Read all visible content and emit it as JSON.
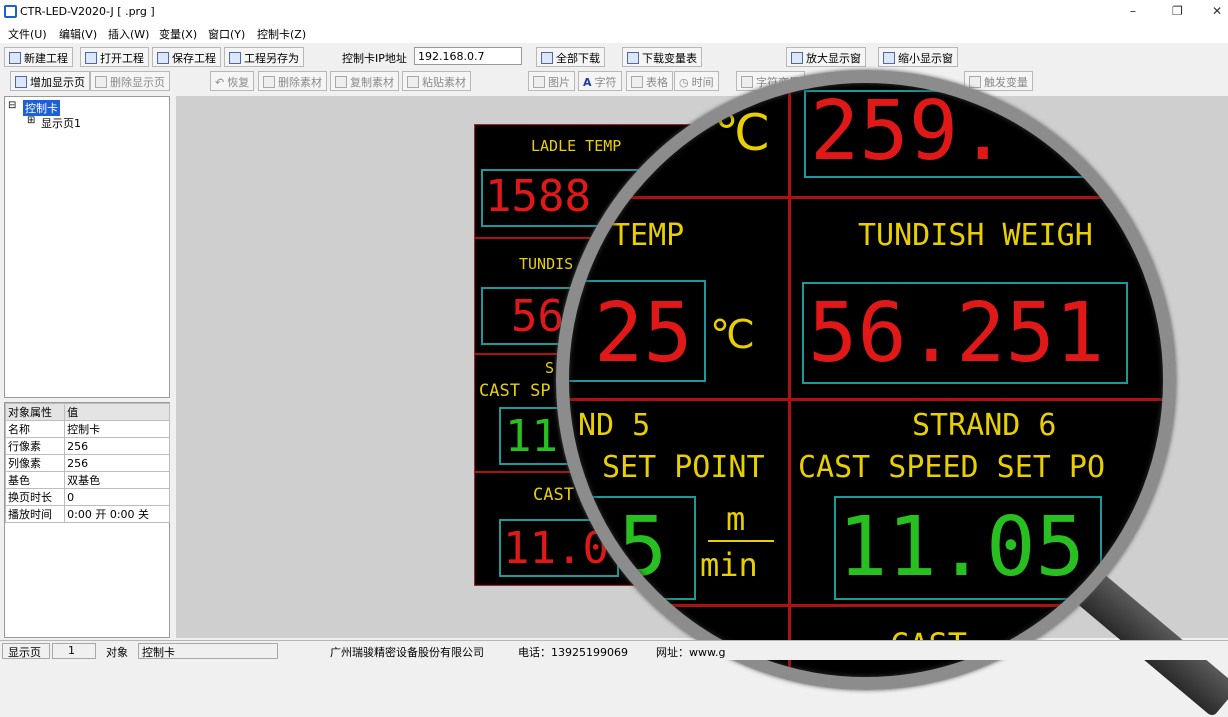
{
  "window": {
    "title": "CTR-LED-V2020-J  [     .prg ]",
    "min": "–",
    "max": "❐",
    "close": "✕"
  },
  "menu": [
    "文件(U)",
    "编辑(V)",
    "插入(W)",
    "变量(X)",
    "窗口(Y)",
    "控制卡(Z)"
  ],
  "toolbar1": {
    "new": "新建工程",
    "open": "打开工程",
    "save": "保存工程",
    "saveas": "工程另存为",
    "ip_label": "控制卡IP地址",
    "ip_value": "192.168.0.7",
    "download_all": "全部下载",
    "download_vars": "下载变量表",
    "zoom_in": "放大显示窗",
    "zoom_out": "缩小显示窗"
  },
  "toolbar2": {
    "add_page": "增加显示页",
    "delete_page": "删除显示页",
    "undo": "恢复",
    "delete_item": "删除素材",
    "copy_item": "复制素材",
    "paste_item": "粘贴素材",
    "image": "图片",
    "text": "字符",
    "table": "表格",
    "time": "时间",
    "var_char": "字符变量",
    "trigger_var": "触发变量"
  },
  "tree": {
    "root": "控制卡",
    "child": "显示页1"
  },
  "props": {
    "headers": [
      "对象属性",
      "值"
    ],
    "rows": [
      [
        "名称",
        "控制卡"
      ],
      [
        "行像素",
        "256"
      ],
      [
        "列像素",
        "256"
      ],
      [
        "基色",
        "双基色"
      ],
      [
        "换页时长",
        "0"
      ],
      [
        "播放时间",
        "0:00 开 0:00 关"
      ]
    ]
  },
  "led": {
    "ladle_temp": "LADLE TEMP",
    "ladle_value": "1588",
    "tundish": "TUNDIS",
    "tundish_value": "56",
    "strand_s": "S",
    "cast_sp": "CAST SP",
    "speed_value": "11",
    "cast": "CAST",
    "cast_value": "11.0"
  },
  "lens": {
    "deg_top": "℃",
    "top_value": "259.",
    "temp_label": "TEMP",
    "weight_label": "TUNDISH WEIGH",
    "temp_value": "25",
    "deg": "℃",
    "weight_value": "56.251",
    "strand5": "ND 5",
    "strand6": "STRAND 6",
    "setpoint5": "SET POINT",
    "setpoint6": "CAST SPEED SET PO",
    "speed5": "5",
    "unit_m": "m",
    "unit_min": "min",
    "speed6": "11.05",
    "cast_bottom": "CAST"
  },
  "status": {
    "page_label": "显示页",
    "page_no": "1",
    "obj_label": "对象",
    "obj_value": "控制卡",
    "company": "广州瑞骏精密设备股份有限公司",
    "phone": "电话：13925199069",
    "web": "网址：www.g"
  },
  "colors": {
    "led_yellow": "#e8d000",
    "led_red": "#e01818",
    "led_green": "#28c020",
    "led_frame": "#1a9a9a"
  }
}
